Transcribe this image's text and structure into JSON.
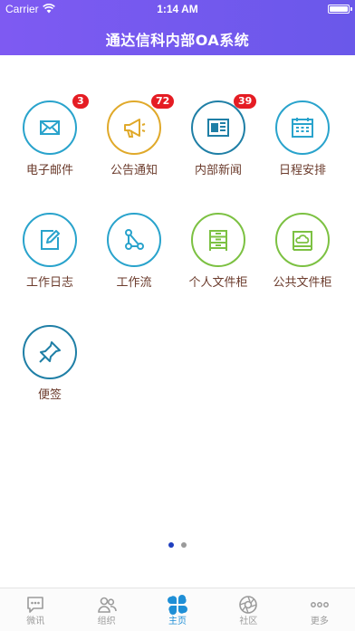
{
  "status": {
    "carrier": "Carrier",
    "time": "1:14 AM"
  },
  "header": {
    "title": "通达信科内部OA系统"
  },
  "apps": [
    {
      "label": "电子邮件",
      "badge": "3",
      "icon": "mail-icon",
      "color": "#29a3cc"
    },
    {
      "label": "公告通知",
      "badge": "72",
      "icon": "megaphone-icon",
      "color": "#e0a92a"
    },
    {
      "label": "内部新闻",
      "badge": "39",
      "icon": "newspaper-icon",
      "color": "#1f7fa6"
    },
    {
      "label": "日程安排",
      "badge": "",
      "icon": "calendar-icon",
      "color": "#29a3cc"
    },
    {
      "label": "工作日志",
      "badge": "",
      "icon": "edit-note-icon",
      "color": "#29a3cc"
    },
    {
      "label": "工作流",
      "badge": "",
      "icon": "workflow-icon",
      "color": "#29a3cc"
    },
    {
      "label": "个人文件柜",
      "badge": "",
      "icon": "file-cabinet-icon",
      "color": "#7cc142"
    },
    {
      "label": "公共文件柜",
      "badge": "",
      "icon": "cloud-cabinet-icon",
      "color": "#7cc142"
    },
    {
      "label": "便签",
      "badge": "",
      "icon": "pushpin-icon",
      "color": "#1f7fa6"
    }
  ],
  "pager": {
    "pages": 2,
    "current": 1
  },
  "tabs": [
    {
      "label": "微讯",
      "icon": "chat-icon",
      "active": false
    },
    {
      "label": "组织",
      "icon": "people-icon",
      "active": false
    },
    {
      "label": "主页",
      "icon": "home-grid-icon",
      "active": true
    },
    {
      "label": "社区",
      "icon": "aperture-icon",
      "active": false
    },
    {
      "label": "更多",
      "icon": "more-icon",
      "active": false
    }
  ],
  "colors": {
    "header": "#7e5af2",
    "badge": "#e51c23",
    "label": "#6b3b2c",
    "tab_active": "#1f8fd6"
  }
}
